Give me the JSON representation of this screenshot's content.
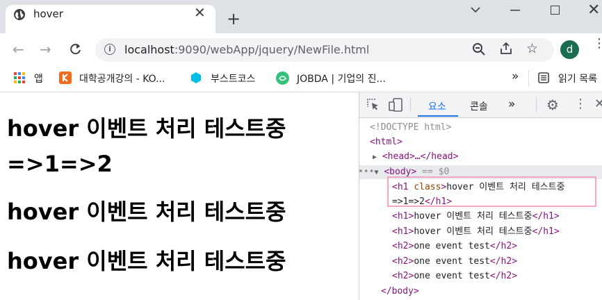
{
  "tab": {
    "title": "hover",
    "close_icon": "close-icon",
    "new_tab_icon": "plus-icon"
  },
  "window": {
    "minimize_icon": "chevron-down-icon",
    "maximize_icon": "maximize-icon",
    "close_icon": "close-icon"
  },
  "toolbar": {
    "back_icon": "arrow-left-icon",
    "forward_icon": "arrow-right-icon",
    "reload_icon": "reload-icon",
    "url_host": "localhost",
    "url_path": ":9090/webApp/jquery/NewFile.html",
    "avatar_letter": "d"
  },
  "bookmarks": {
    "apps_label": "앱",
    "items": [
      {
        "label": "대학공개강의 - KO..."
      },
      {
        "label": "부스트코스"
      },
      {
        "label": "JOBDA | 기업의 진..."
      }
    ],
    "overflow_label": "»",
    "reading_list_label": "읽기 목록"
  },
  "page": {
    "headings": [
      {
        "line1": "hover 이벤트 처리 테스트중",
        "line2": "=>1=>2"
      },
      {
        "line1": "hover 이벤트 처리 테스트중"
      },
      {
        "line1": "hover 이벤트 처리 테스트중"
      }
    ]
  },
  "devtools": {
    "tabs": {
      "elements": "요소",
      "console": "콘솔",
      "more": "»"
    },
    "dom": {
      "doctype": "<!DOCTYPE html>",
      "html_open": "<html>",
      "head": "<head>…</head>",
      "body_prefix": "•••",
      "body_open": "<body>",
      "body_eq": "== $0",
      "h1_selected_tag": "<h1 ",
      "h1_selected_attr": "class",
      "h1_selected_close": ">",
      "h1_selected_text": "hover 이벤트 처리 테스트중",
      "h1_selected_line2": "=>1=>2",
      "h1_selected_end": "</h1>",
      "h1_rows": [
        "hover 이벤트 처리 테스트중",
        "hover 이벤트 처리 테스트중"
      ],
      "h2_rows": [
        "one event test",
        "one event test",
        "one event test"
      ],
      "body_close": "</body>"
    }
  },
  "colors": {
    "accent": "#1a73e8",
    "tag": "#881280",
    "attr": "#994500",
    "selection_border": "#f4a6c6"
  }
}
